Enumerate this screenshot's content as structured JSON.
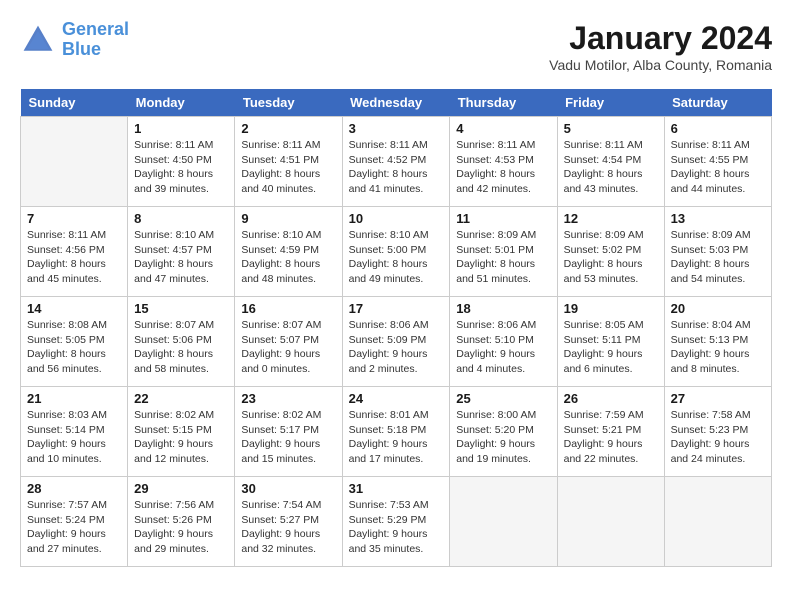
{
  "logo": {
    "line1": "General",
    "line2": "Blue"
  },
  "title": "January 2024",
  "location": "Vadu Motilor, Alba County, Romania",
  "days_of_week": [
    "Sunday",
    "Monday",
    "Tuesday",
    "Wednesday",
    "Thursday",
    "Friday",
    "Saturday"
  ],
  "weeks": [
    [
      {
        "num": "",
        "sunrise": "",
        "sunset": "",
        "daylight": "",
        "empty": true
      },
      {
        "num": "1",
        "sunrise": "Sunrise: 8:11 AM",
        "sunset": "Sunset: 4:50 PM",
        "daylight": "Daylight: 8 hours and 39 minutes."
      },
      {
        "num": "2",
        "sunrise": "Sunrise: 8:11 AM",
        "sunset": "Sunset: 4:51 PM",
        "daylight": "Daylight: 8 hours and 40 minutes."
      },
      {
        "num": "3",
        "sunrise": "Sunrise: 8:11 AM",
        "sunset": "Sunset: 4:52 PM",
        "daylight": "Daylight: 8 hours and 41 minutes."
      },
      {
        "num": "4",
        "sunrise": "Sunrise: 8:11 AM",
        "sunset": "Sunset: 4:53 PM",
        "daylight": "Daylight: 8 hours and 42 minutes."
      },
      {
        "num": "5",
        "sunrise": "Sunrise: 8:11 AM",
        "sunset": "Sunset: 4:54 PM",
        "daylight": "Daylight: 8 hours and 43 minutes."
      },
      {
        "num": "6",
        "sunrise": "Sunrise: 8:11 AM",
        "sunset": "Sunset: 4:55 PM",
        "daylight": "Daylight: 8 hours and 44 minutes."
      }
    ],
    [
      {
        "num": "7",
        "sunrise": "Sunrise: 8:11 AM",
        "sunset": "Sunset: 4:56 PM",
        "daylight": "Daylight: 8 hours and 45 minutes."
      },
      {
        "num": "8",
        "sunrise": "Sunrise: 8:10 AM",
        "sunset": "Sunset: 4:57 PM",
        "daylight": "Daylight: 8 hours and 47 minutes."
      },
      {
        "num": "9",
        "sunrise": "Sunrise: 8:10 AM",
        "sunset": "Sunset: 4:59 PM",
        "daylight": "Daylight: 8 hours and 48 minutes."
      },
      {
        "num": "10",
        "sunrise": "Sunrise: 8:10 AM",
        "sunset": "Sunset: 5:00 PM",
        "daylight": "Daylight: 8 hours and 49 minutes."
      },
      {
        "num": "11",
        "sunrise": "Sunrise: 8:09 AM",
        "sunset": "Sunset: 5:01 PM",
        "daylight": "Daylight: 8 hours and 51 minutes."
      },
      {
        "num": "12",
        "sunrise": "Sunrise: 8:09 AM",
        "sunset": "Sunset: 5:02 PM",
        "daylight": "Daylight: 8 hours and 53 minutes."
      },
      {
        "num": "13",
        "sunrise": "Sunrise: 8:09 AM",
        "sunset": "Sunset: 5:03 PM",
        "daylight": "Daylight: 8 hours and 54 minutes."
      }
    ],
    [
      {
        "num": "14",
        "sunrise": "Sunrise: 8:08 AM",
        "sunset": "Sunset: 5:05 PM",
        "daylight": "Daylight: 8 hours and 56 minutes."
      },
      {
        "num": "15",
        "sunrise": "Sunrise: 8:07 AM",
        "sunset": "Sunset: 5:06 PM",
        "daylight": "Daylight: 8 hours and 58 minutes."
      },
      {
        "num": "16",
        "sunrise": "Sunrise: 8:07 AM",
        "sunset": "Sunset: 5:07 PM",
        "daylight": "Daylight: 9 hours and 0 minutes."
      },
      {
        "num": "17",
        "sunrise": "Sunrise: 8:06 AM",
        "sunset": "Sunset: 5:09 PM",
        "daylight": "Daylight: 9 hours and 2 minutes."
      },
      {
        "num": "18",
        "sunrise": "Sunrise: 8:06 AM",
        "sunset": "Sunset: 5:10 PM",
        "daylight": "Daylight: 9 hours and 4 minutes."
      },
      {
        "num": "19",
        "sunrise": "Sunrise: 8:05 AM",
        "sunset": "Sunset: 5:11 PM",
        "daylight": "Daylight: 9 hours and 6 minutes."
      },
      {
        "num": "20",
        "sunrise": "Sunrise: 8:04 AM",
        "sunset": "Sunset: 5:13 PM",
        "daylight": "Daylight: 9 hours and 8 minutes."
      }
    ],
    [
      {
        "num": "21",
        "sunrise": "Sunrise: 8:03 AM",
        "sunset": "Sunset: 5:14 PM",
        "daylight": "Daylight: 9 hours and 10 minutes."
      },
      {
        "num": "22",
        "sunrise": "Sunrise: 8:02 AM",
        "sunset": "Sunset: 5:15 PM",
        "daylight": "Daylight: 9 hours and 12 minutes."
      },
      {
        "num": "23",
        "sunrise": "Sunrise: 8:02 AM",
        "sunset": "Sunset: 5:17 PM",
        "daylight": "Daylight: 9 hours and 15 minutes."
      },
      {
        "num": "24",
        "sunrise": "Sunrise: 8:01 AM",
        "sunset": "Sunset: 5:18 PM",
        "daylight": "Daylight: 9 hours and 17 minutes."
      },
      {
        "num": "25",
        "sunrise": "Sunrise: 8:00 AM",
        "sunset": "Sunset: 5:20 PM",
        "daylight": "Daylight: 9 hours and 19 minutes."
      },
      {
        "num": "26",
        "sunrise": "Sunrise: 7:59 AM",
        "sunset": "Sunset: 5:21 PM",
        "daylight": "Daylight: 9 hours and 22 minutes."
      },
      {
        "num": "27",
        "sunrise": "Sunrise: 7:58 AM",
        "sunset": "Sunset: 5:23 PM",
        "daylight": "Daylight: 9 hours and 24 minutes."
      }
    ],
    [
      {
        "num": "28",
        "sunrise": "Sunrise: 7:57 AM",
        "sunset": "Sunset: 5:24 PM",
        "daylight": "Daylight: 9 hours and 27 minutes."
      },
      {
        "num": "29",
        "sunrise": "Sunrise: 7:56 AM",
        "sunset": "Sunset: 5:26 PM",
        "daylight": "Daylight: 9 hours and 29 minutes."
      },
      {
        "num": "30",
        "sunrise": "Sunrise: 7:54 AM",
        "sunset": "Sunset: 5:27 PM",
        "daylight": "Daylight: 9 hours and 32 minutes."
      },
      {
        "num": "31",
        "sunrise": "Sunrise: 7:53 AM",
        "sunset": "Sunset: 5:29 PM",
        "daylight": "Daylight: 9 hours and 35 minutes."
      },
      {
        "num": "",
        "sunrise": "",
        "sunset": "",
        "daylight": "",
        "empty": true
      },
      {
        "num": "",
        "sunrise": "",
        "sunset": "",
        "daylight": "",
        "empty": true
      },
      {
        "num": "",
        "sunrise": "",
        "sunset": "",
        "daylight": "",
        "empty": true
      }
    ]
  ]
}
